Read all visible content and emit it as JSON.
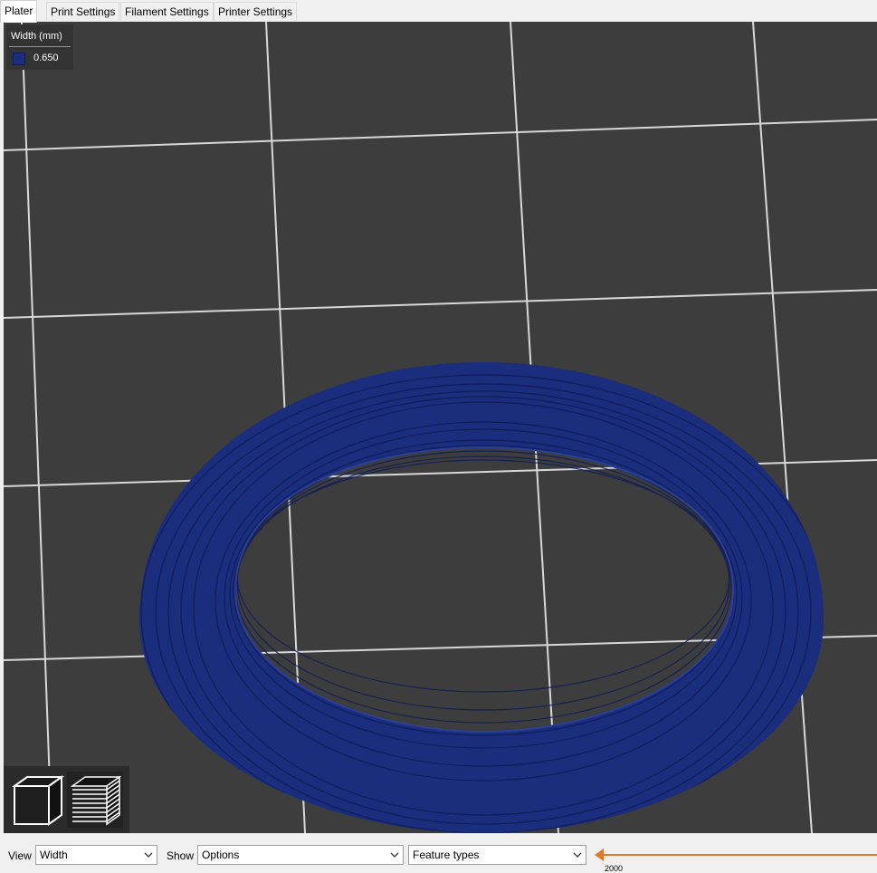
{
  "tabs": [
    {
      "label": "Plater",
      "active": true
    },
    {
      "label": "Print Settings",
      "active": false
    },
    {
      "label": "Filament Settings",
      "active": false
    },
    {
      "label": "Printer Settings",
      "active": false
    }
  ],
  "legend": {
    "title": "Width (mm)",
    "value": "0.650",
    "swatch_color": "#1b2d7d",
    "accent_color": "#e07a2e"
  },
  "view_buttons": {
    "view3d_icon": "cube-icon",
    "preview_icon": "layers-icon"
  },
  "toolbar": {
    "view_label": "View",
    "view_value": "Width",
    "show_label": "Show",
    "show_value": "Options",
    "features_value": "Feature types",
    "slider_value": "2000"
  },
  "colors": {
    "viewport_bg": "#3d3d3d",
    "grid_line": "#d8d8d8",
    "model": "#1b2d7d"
  }
}
